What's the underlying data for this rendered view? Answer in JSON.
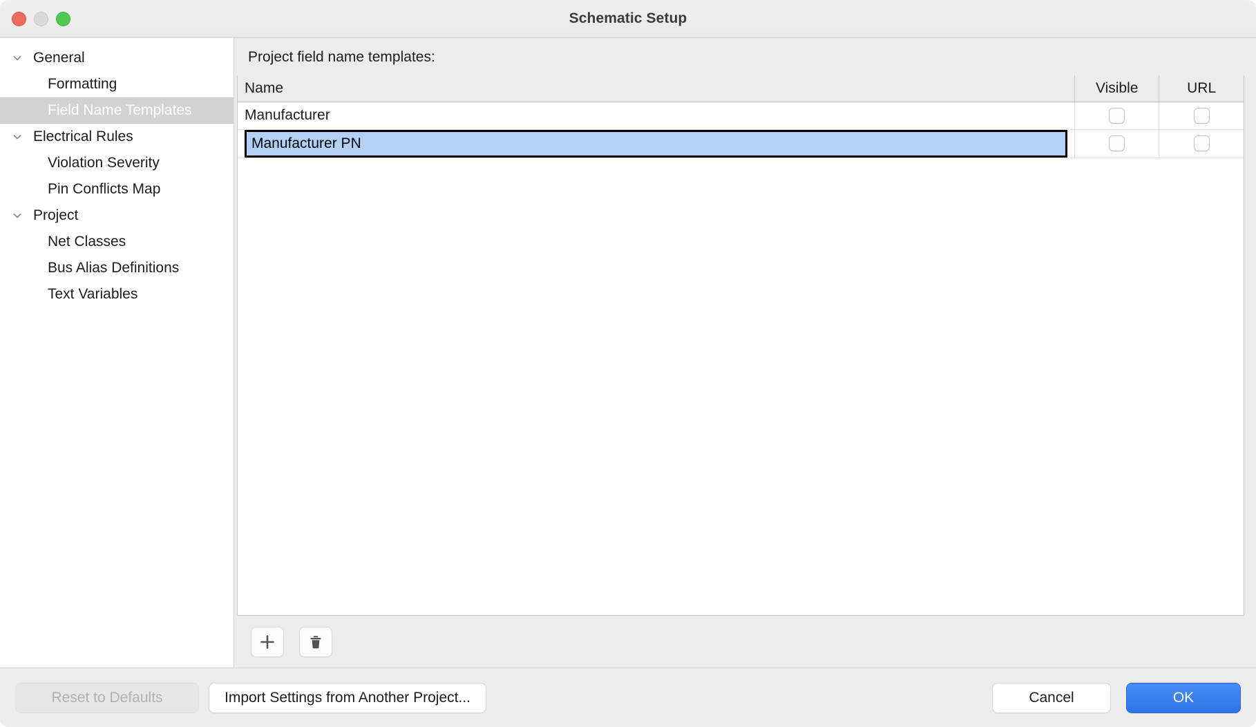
{
  "window": {
    "title": "Schematic Setup",
    "traffic_lights": [
      "close-button",
      "minimize-button",
      "zoom-button"
    ],
    "accent_color": "#2d73e8",
    "selection_color": "#b3d1f7",
    "sidebar_selection_color": "#d2d2d2"
  },
  "sidebar": {
    "items": [
      {
        "label": "General",
        "level": 0,
        "expandable": true,
        "expanded": true,
        "selected": false
      },
      {
        "label": "Formatting",
        "level": 1,
        "expandable": false,
        "expanded": false,
        "selected": false
      },
      {
        "label": "Field Name Templates",
        "level": 1,
        "expandable": false,
        "expanded": false,
        "selected": true
      },
      {
        "label": "Electrical Rules",
        "level": 0,
        "expandable": true,
        "expanded": true,
        "selected": false
      },
      {
        "label": "Violation Severity",
        "level": 1,
        "expandable": false,
        "expanded": false,
        "selected": false
      },
      {
        "label": "Pin Conflicts Map",
        "level": 1,
        "expandable": false,
        "expanded": false,
        "selected": false
      },
      {
        "label": "Project",
        "level": 0,
        "expandable": true,
        "expanded": true,
        "selected": false
      },
      {
        "label": "Net Classes",
        "level": 1,
        "expandable": false,
        "expanded": false,
        "selected": false
      },
      {
        "label": "Bus Alias Definitions",
        "level": 1,
        "expandable": false,
        "expanded": false,
        "selected": false
      },
      {
        "label": "Text Variables",
        "level": 1,
        "expandable": false,
        "expanded": false,
        "selected": false
      }
    ]
  },
  "main": {
    "section_label": "Project field name templates:",
    "table": {
      "columns": [
        "Name",
        "Visible",
        "URL"
      ],
      "rows": [
        {
          "name": "Manufacturer",
          "visible": false,
          "url": false,
          "selected": false,
          "editing": false
        },
        {
          "name": "Manufacturer PN",
          "visible": false,
          "url": false,
          "selected": true,
          "editing": true
        }
      ]
    },
    "toolbar": {
      "add_icon": "plus-icon",
      "delete_icon": "trash-icon"
    }
  },
  "footer": {
    "reset_label": "Reset to Defaults",
    "reset_enabled": false,
    "import_label": "Import Settings from Another Project...",
    "cancel_label": "Cancel",
    "ok_label": "OK"
  }
}
